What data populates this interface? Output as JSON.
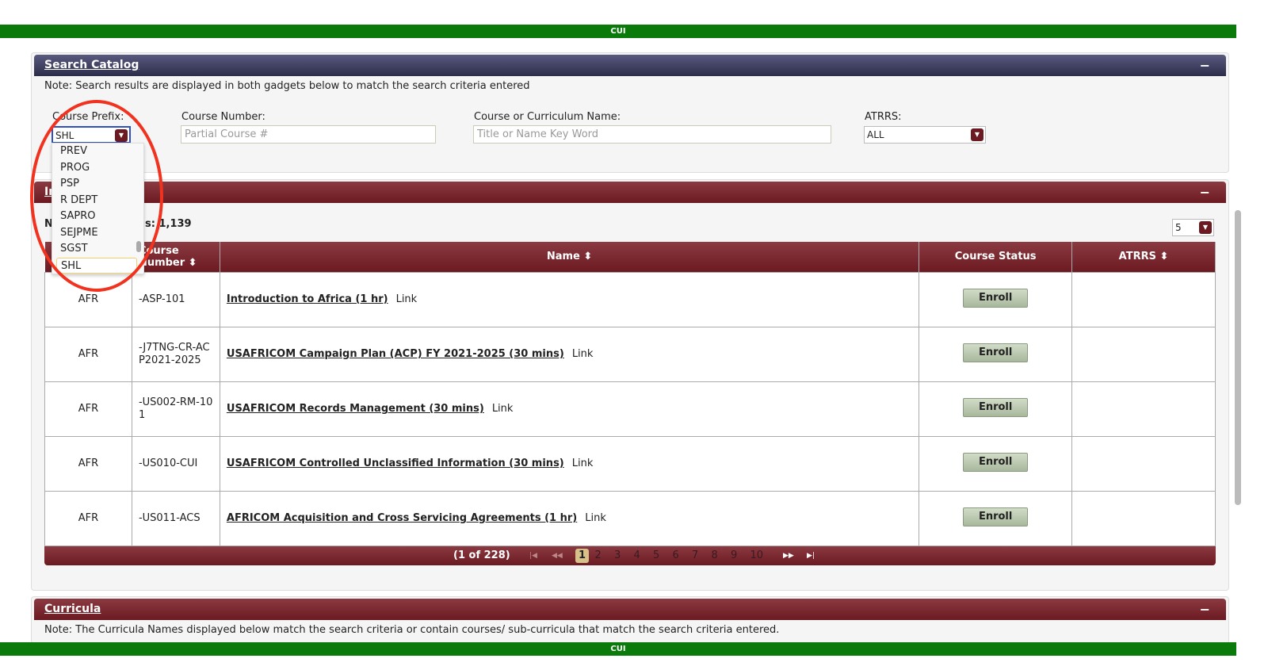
{
  "banner": "CUI",
  "search": {
    "title": "Search Catalog",
    "note": "Note: Search results are displayed in both gadgets below to match the search criteria entered",
    "prefix_label": "Course Prefix:",
    "prefix_value": "SHL",
    "number_label": "Course Number:",
    "number_placeholder": "Partial Course #",
    "name_label": "Course or Curriculum Name:",
    "name_placeholder": "Title or Name Key Word",
    "atrrs_label": "ATRRS:",
    "atrrs_value": "ALL",
    "prefix_options": [
      "PREV",
      "PROG",
      "PSP",
      "R DEPT",
      "SAPRO",
      "SEJPME",
      "SGST",
      "SHL"
    ]
  },
  "courses": {
    "title_visible": "In",
    "count_prefix": "N",
    "count_suffix": "s: 1,139",
    "page_size": "5",
    "headers": [
      "Course Number",
      "Name",
      "Course Status",
      "ATRRS"
    ],
    "rows": [
      {
        "prefix": "AFR",
        "number": "-ASP-101",
        "name": "Introduction to Africa (1 hr)",
        "link": "Link",
        "status": "Enroll"
      },
      {
        "prefix": "AFR",
        "number": "-J7TNG-CR-ACP2021-2025",
        "name": "USAFRICOM Campaign Plan (ACP) FY 2021-2025 (30 mins)",
        "link": "Link",
        "status": "Enroll"
      },
      {
        "prefix": "AFR",
        "number": "-US002-RM-101",
        "name": "USAFRICOM Records Management (30 mins)",
        "link": "Link",
        "status": "Enroll"
      },
      {
        "prefix": "AFR",
        "number": "-US010-CUI",
        "name": "USAFRICOM Controlled Unclassified Information (30 mins)",
        "link": "Link",
        "status": "Enroll"
      },
      {
        "prefix": "AFR",
        "number": "-US011-ACS",
        "name": "AFRICOM Acquisition and Cross Servicing Agreements (1 hr)",
        "link": "Link",
        "status": "Enroll"
      }
    ],
    "pager": {
      "info": "(1 of 228)",
      "pages": [
        "1",
        "2",
        "3",
        "4",
        "5",
        "6",
        "7",
        "8",
        "9",
        "10"
      ],
      "current": "1"
    }
  },
  "curricula": {
    "title": "Curricula",
    "note": "Note: The Curricula Names displayed below match the search criteria or contain courses/ sub-curricula that match the search criteria entered."
  },
  "colors": {
    "banner": "#0a7a0a",
    "header_maroon": "#6a1a20",
    "header_navy": "#2c2c4a",
    "annotation": "#f0321e"
  }
}
